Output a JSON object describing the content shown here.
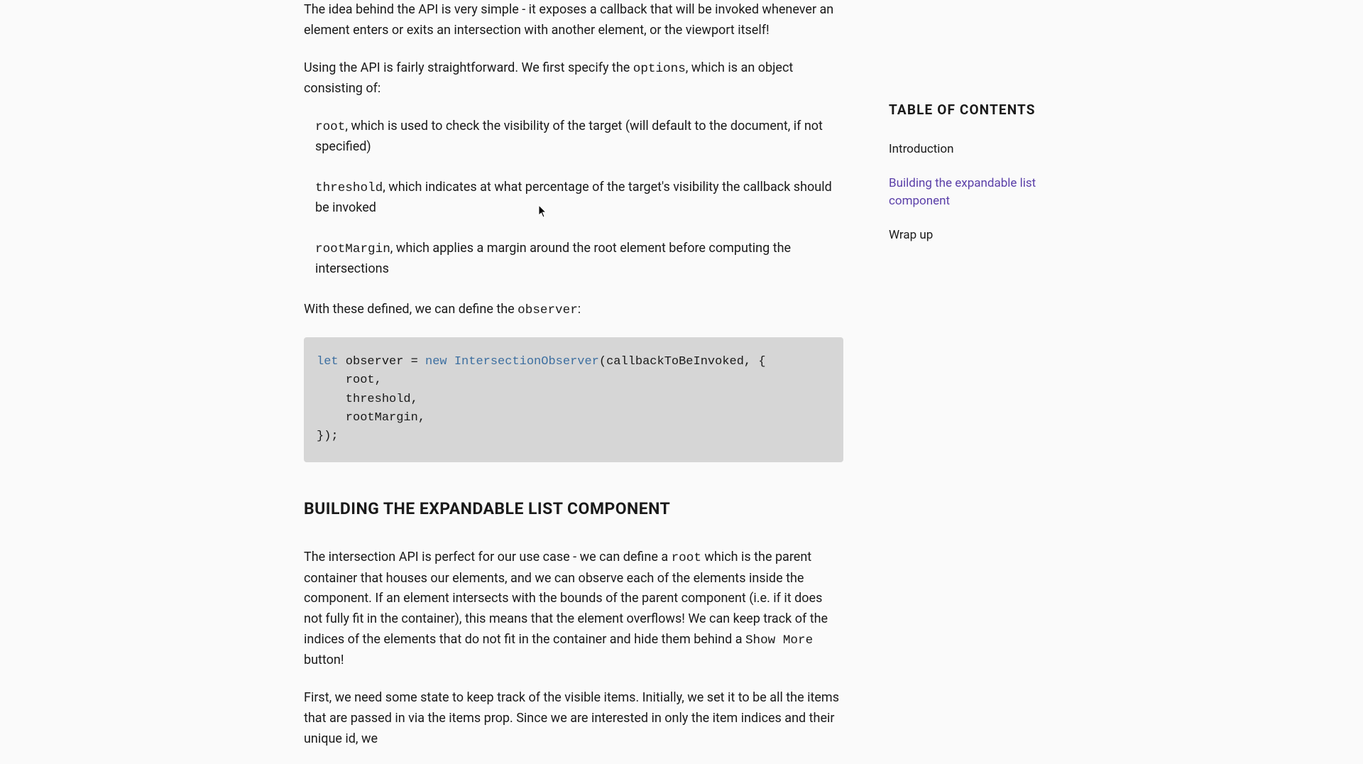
{
  "article": {
    "intro_p1": "The idea behind the API is very simple - it exposes a callback that will be invoked whenever an element enters or exits an intersection with another element, or the viewport itself!",
    "intro_p2_a": "Using the API is fairly straightforward. We first specify the ",
    "intro_p2_code": "options",
    "intro_p2_b": ", which is an object consisting of:",
    "options_list": {
      "root_code": "root",
      "root_text": ", which is used to check the visibility of the target (will default to the document, if not specified)",
      "threshold_code": "threshold",
      "threshold_text": ", which indicates at what percentage of the target's visibility the callback should be invoked",
      "rootMargin_code": "rootMargin",
      "rootMargin_text": ", which applies a margin around the root element before computing the intersections"
    },
    "observer_intro_a": "With these defined, we can define the ",
    "observer_intro_code": "observer",
    "observer_intro_b": ":",
    "code": {
      "kw_let": "let",
      "var_observer": " observer = ",
      "kw_new": "new",
      "type_io": " IntersectionObserver",
      "rest_line1": "(callbackToBeInvoked, {",
      "line2": "    root,",
      "line3": "    threshold,",
      "line4": "    rootMargin,",
      "line5": "});"
    },
    "section_heading": "BUILDING THE EXPANDABLE LIST COMPONENT",
    "build_p1_a": "The intersection API is perfect for our use case - we can define a ",
    "build_p1_code_root": "root",
    "build_p1_b": " which is the parent container that houses our elements, and we can observe each of the elements inside the component. If an element intersects with the bounds of the parent component (i.e. if it does not fully fit in the container), this means that the element overflows! We can keep track of the indices of the elements that do not fit in the container and hide them behind a ",
    "build_p1_code_show": "Show More",
    "build_p1_c": " button!",
    "build_p2_a": "First, we need some state to keep track of the visible items. Initially, we set it to be all the items that are",
    "build_p2_b": "passed in via the items prop. Since we are interested in only the item indices and their unique id, we"
  },
  "toc": {
    "title": "TABLE OF CONTENTS",
    "items": [
      {
        "label": "Introduction",
        "active": false
      },
      {
        "label": "Building the expandable list component",
        "active": true
      },
      {
        "label": "Wrap up",
        "active": false
      }
    ]
  }
}
